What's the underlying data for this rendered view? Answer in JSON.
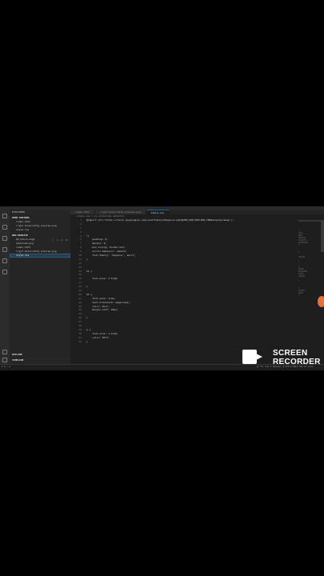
{
  "window": {
    "title": ""
  },
  "sidebar": {
    "title": "EXPLORER",
    "open_editors_header": "OPEN EDITORS",
    "open_editors": [
      "index.html",
      "crypt minecraftg preview.png",
      "style.css"
    ],
    "project_header": "NEW WEBSITE",
    "files": [
      {
        "name": "DS_Store.edge"
      },
      {
        "name": "download.png"
      },
      {
        "name": "index.html"
      },
      {
        "name": "crypt minecraftg preview.png"
      },
      {
        "name": "style.css",
        "active": true
      }
    ],
    "bottom": [
      "OUTLINE",
      "TIMELINE"
    ]
  },
  "tabs": [
    {
      "label": "index.html",
      "active": false
    },
    {
      "label": "crypt minecraftg preview.png",
      "active": false
    },
    {
      "label": "style.css",
      "active": true
    }
  ],
  "breadcrumb": "style.css > {} universal-selector",
  "code_lines": [
    "@import url('https://fonts.googleapis.com/css2?family=Poppins:wght@300;400;500;600;700&display=swap');",
    "",
    "",
    "",
    "*{",
    "    padding: 0;",
    "    margin: 0;",
    "    box-sizing: border-box;",
    "    scroll-behavior: smooth;",
    "    font-family: 'Poppins', serif;",
    "}",
    "",
    "",
    "h1 {",
    "",
    "    font-size: 3.5rem;",
    "",
    "}",
    "",
    "h2 {",
    "    font-size: 3rem;",
    "    text-transform: uppercase;",
    "    color: #ccc;",
    "    margin-left: 10px;",
    "",
    "}",
    "",
    "",
    "p {",
    "    font-size: 1.2rem;",
    "    color: #fff;",
    "}"
  ],
  "statusbar": {
    "left": "⊗ 0 ⚠ 0",
    "right": "Ln 33, Col 1   Spaces: 4   UTF-8   CRLF   CSS   Go Live"
  },
  "watermark": {
    "line1": "SCREEN",
    "line2": "RECORDER"
  },
  "colors": {
    "editor_bg": "#1e1e1e",
    "sidebar_bg": "#252526",
    "accent": "#0e639c",
    "recording_dot": "#e8703a"
  }
}
